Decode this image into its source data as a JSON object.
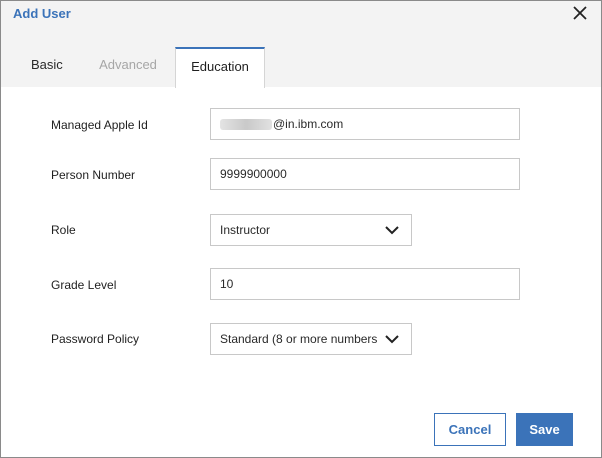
{
  "dialog": {
    "title": "Add User",
    "close_icon": "close-icon"
  },
  "tabs": [
    {
      "label": "Basic",
      "state": "normal"
    },
    {
      "label": "Advanced",
      "state": "disabled"
    },
    {
      "label": "Education",
      "state": "active"
    }
  ],
  "form": {
    "managed_apple_id": {
      "label": "Managed Apple Id",
      "value_visible_suffix": "@in.ibm.com"
    },
    "person_number": {
      "label": "Person Number",
      "value": "9999900000"
    },
    "role": {
      "label": "Role",
      "value": "Instructor"
    },
    "grade_level": {
      "label": "Grade Level",
      "value": "10"
    },
    "password_policy": {
      "label": "Password Policy",
      "value": "Standard (8 or more numbers"
    }
  },
  "actions": {
    "cancel_label": "Cancel",
    "save_label": "Save"
  },
  "colors": {
    "accent": "#3b73b9",
    "header_bg": "#f3f3f3",
    "disabled_text": "#a6a6a6"
  }
}
